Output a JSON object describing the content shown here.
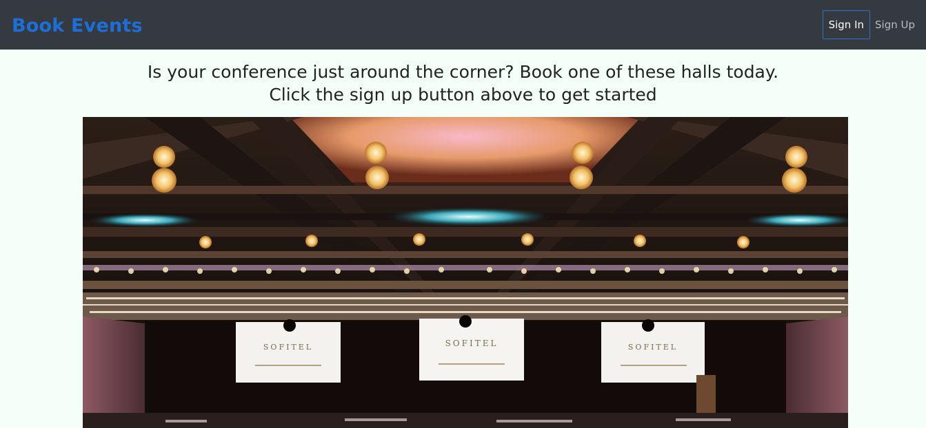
{
  "navbar": {
    "brand": "Book Events",
    "sign_in_label": "Sign In",
    "sign_up_label": "Sign Up"
  },
  "hero": {
    "line1": "Is your conference just around the corner? Book one of these halls today.",
    "line2": "Click the sign up button above to get started",
    "image_screen_text": "SOFITEL"
  },
  "colors": {
    "navbar_bg": "#343a40",
    "brand": "#1c6fd6",
    "page_bg": "#f3fff8",
    "sign_in_border": "#2f6fd0"
  }
}
